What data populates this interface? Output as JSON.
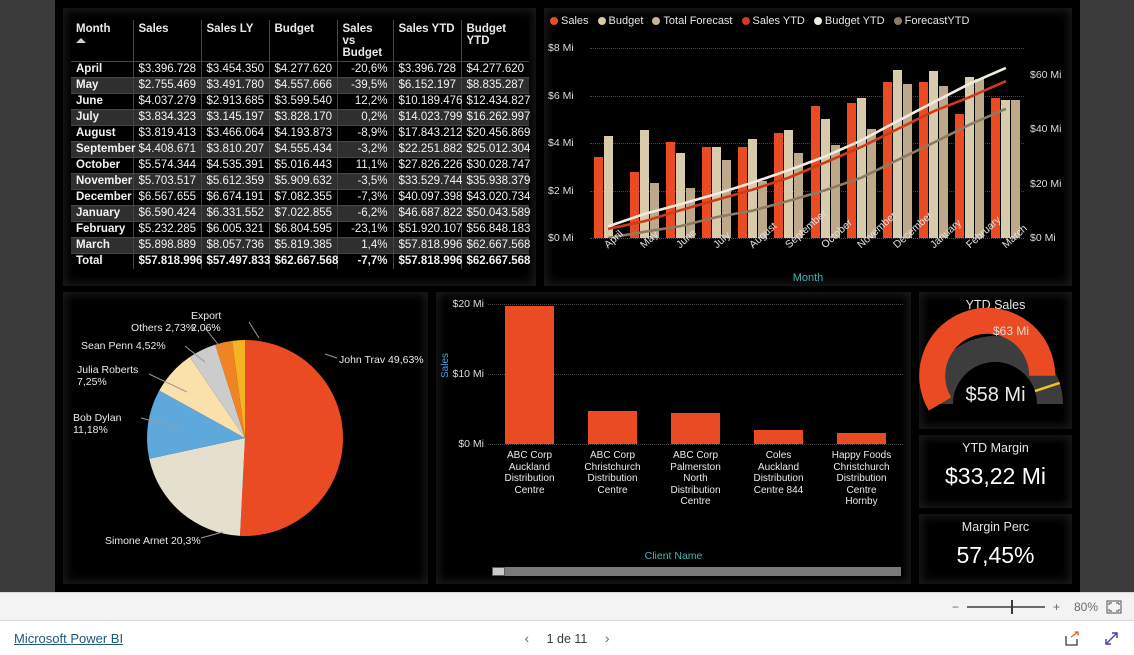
{
  "report": {
    "brand": "Microsoft Power BI",
    "page_indicator": "1 de 11",
    "prev_arrow": "‹",
    "next_arrow": "›",
    "zoom_level": "80%",
    "zoom_minus": "−",
    "zoom_plus": "+",
    "accent_orange": "#eb4b22",
    "accent_tan": "#d8cbab",
    "accent_forecast": "#bda889",
    "canvas_bg": "#000000",
    "axis_title_color": "#3fb8b0"
  },
  "table": {
    "name": "Monthly Sales Table",
    "sort_column": "Month",
    "sort_direction": "ascending",
    "columns": [
      "Month",
      "Sales",
      "Sales LY",
      "Budget",
      "Sales vs Budget",
      "Sales YTD",
      "Budget YTD"
    ],
    "rows": [
      {
        "month": "April",
        "sales": "$3.396.728",
        "sales_ly": "$3.454.350",
        "budget": "$4.277.620",
        "svb": "-20,6%",
        "sales_ytd": "$3.396.728",
        "budget_ytd": "$4.277.620"
      },
      {
        "month": "May",
        "sales": "$2.755.469",
        "sales_ly": "$3.491.780",
        "budget": "$4.557.666",
        "svb": "-39,5%",
        "sales_ytd": "$6.152.197",
        "budget_ytd": "$8.835.287"
      },
      {
        "month": "June",
        "sales": "$4.037.279",
        "sales_ly": "$2.913.685",
        "budget": "$3.599.540",
        "svb": "12,2%",
        "sales_ytd": "$10.189.476",
        "budget_ytd": "$12.434.827"
      },
      {
        "month": "July",
        "sales": "$3.834.323",
        "sales_ly": "$3.145.197",
        "budget": "$3.828.170",
        "svb": "0,2%",
        "sales_ytd": "$14.023.799",
        "budget_ytd": "$16.262.997"
      },
      {
        "month": "August",
        "sales": "$3.819.413",
        "sales_ly": "$3.466.064",
        "budget": "$4.193.873",
        "svb": "-8,9%",
        "sales_ytd": "$17.843.212",
        "budget_ytd": "$20.456.869"
      },
      {
        "month": "September",
        "sales": "$4.408.671",
        "sales_ly": "$3.810.207",
        "budget": "$4.555.434",
        "svb": "-3,2%",
        "sales_ytd": "$22.251.882",
        "budget_ytd": "$25.012.304"
      },
      {
        "month": "October",
        "sales": "$5.574.344",
        "sales_ly": "$4.535.391",
        "budget": "$5.016.443",
        "svb": "11,1%",
        "sales_ytd": "$27.826.226",
        "budget_ytd": "$30.028.747"
      },
      {
        "month": "November",
        "sales": "$5.703.517",
        "sales_ly": "$5.612.359",
        "budget": "$5.909.632",
        "svb": "-3,5%",
        "sales_ytd": "$33.529.744",
        "budget_ytd": "$35.938.379"
      },
      {
        "month": "December",
        "sales": "$6.567.655",
        "sales_ly": "$6.674.191",
        "budget": "$7.082.355",
        "svb": "-7,3%",
        "sales_ytd": "$40.097.398",
        "budget_ytd": "$43.020.734"
      },
      {
        "month": "January",
        "sales": "$6.590.424",
        "sales_ly": "$6.331.552",
        "budget": "$7.022.855",
        "svb": "-6,2%",
        "sales_ytd": "$46.687.822",
        "budget_ytd": "$50.043.589"
      },
      {
        "month": "February",
        "sales": "$5.232.285",
        "sales_ly": "$6.005.321",
        "budget": "$6.804.595",
        "svb": "-23,1%",
        "sales_ytd": "$51.920.107",
        "budget_ytd": "$56.848.183"
      },
      {
        "month": "March",
        "sales": "$5.898.889",
        "sales_ly": "$8.057.736",
        "budget": "$5.819.385",
        "svb": "1,4%",
        "sales_ytd": "$57.818.996",
        "budget_ytd": "$62.667.568"
      },
      {
        "month": "Total",
        "sales": "$57.818.996",
        "sales_ly": "$57.497.833",
        "budget": "$62.667.568",
        "svb": "-7,7%",
        "sales_ytd": "$57.818.996",
        "budget_ytd": "$62.667.568"
      }
    ]
  },
  "chart_data": [
    {
      "id": "combo",
      "type": "bar",
      "title": "",
      "xlabel": "Month",
      "ylabel": "",
      "categories": [
        "April",
        "May",
        "June",
        "July",
        "August",
        "September",
        "October",
        "November",
        "December",
        "January",
        "February",
        "March"
      ],
      "ylim": [
        0,
        8
      ],
      "ytick_labels": [
        "$0 Mi",
        "$2 Mi",
        "$4 Mi",
        "$6 Mi",
        "$8 Mi"
      ],
      "ytick_values": [
        0,
        2,
        4,
        6,
        8
      ],
      "y2lim": [
        0,
        70
      ],
      "y2tick_labels": [
        "$0 Mi",
        "$20 Mi",
        "$40 Mi",
        "$60 Mi"
      ],
      "y2tick_values": [
        0,
        20,
        40,
        60
      ],
      "grid": true,
      "legend": [
        "Sales",
        "Budget",
        "Total Forecast",
        "Sales YTD",
        "Budget YTD",
        "ForecastYTD"
      ],
      "legend_colors": [
        "#eb4b22",
        "#d8cbab",
        "#c8b595",
        "#cf3b18",
        "#f0ece0",
        "#8c7b63"
      ],
      "legend_position": "top",
      "series": [
        {
          "name": "Sales",
          "kind": "bar",
          "color": "#eb4b22",
          "axis": "left",
          "values": [
            3.4,
            2.76,
            4.04,
            3.83,
            3.82,
            4.41,
            5.57,
            5.7,
            6.57,
            6.59,
            5.23,
            5.9
          ]
        },
        {
          "name": "Budget",
          "kind": "bar",
          "color": "#d8cbab",
          "axis": "left",
          "values": [
            4.28,
            4.56,
            3.6,
            3.83,
            4.19,
            4.56,
            5.02,
            5.91,
            7.08,
            7.02,
            6.8,
            5.82
          ]
        },
        {
          "name": "Total Forecast",
          "kind": "bar",
          "color": "#bda889",
          "axis": "left",
          "values": [
            0.0,
            2.3,
            2.1,
            3.3,
            2.4,
            3.6,
            3.9,
            4.6,
            6.5,
            6.4,
            6.7,
            5.8
          ]
        },
        {
          "name": "Sales YTD",
          "kind": "line",
          "color": "#cf3b18",
          "axis": "right",
          "values": [
            3.4,
            6.15,
            10.19,
            14.02,
            17.84,
            22.25,
            27.83,
            33.53,
            40.1,
            46.69,
            51.92,
            57.82
          ]
        },
        {
          "name": "Budget YTD",
          "kind": "line",
          "color": "#f0ece0",
          "axis": "right",
          "values": [
            4.28,
            8.84,
            12.43,
            16.26,
            20.46,
            25.01,
            30.03,
            35.94,
            43.02,
            50.04,
            56.85,
            62.67
          ]
        },
        {
          "name": "ForecastYTD",
          "kind": "line",
          "color": "#8c7b63",
          "axis": "right",
          "values": [
            0.0,
            2.3,
            4.4,
            7.7,
            10.1,
            13.7,
            17.6,
            22.2,
            28.7,
            35.1,
            41.8,
            47.6
          ]
        }
      ]
    },
    {
      "id": "pie",
      "type": "pie",
      "title": "",
      "labels": [
        "John Trav",
        "Simone Arnet",
        "Bob Dylan",
        "Julia Roberts",
        "Sean Penn",
        "Others",
        "Export"
      ],
      "values": [
        49.63,
        20.3,
        11.18,
        7.25,
        4.52,
        2.73,
        2.06
      ],
      "value_labels": [
        "John Trav 49,63%",
        "Simone Arnet 20,3%",
        "Bob Dylan\n11,18%",
        "Julia Roberts\n7,25%",
        "Sean Penn 4,52%",
        "Others 2,73%",
        "Export\n2,06%"
      ],
      "colors": [
        "#eb4b22",
        "#e5dfcd",
        "#5fa8dc",
        "#fae0aa",
        "#cccccc",
        "#f08322",
        "#f5b323"
      ],
      "legend_position": "labels"
    },
    {
      "id": "client-sales",
      "type": "bar",
      "title": "",
      "xlabel": "Client Name",
      "ylabel": "Sales",
      "categories": [
        "ABC Corp Auckland Distribution Centre",
        "ABC Corp Christchurch Distribution Centre",
        "ABC Corp Palmerston North Distribution Centre",
        "Coles Auckland Distribution Centre 844",
        "Happy Foods Christchurch Distribution Centre Hornby"
      ],
      "values": [
        19.7,
        4.7,
        4.4,
        2.0,
        1.6
      ],
      "ylim": [
        0,
        20
      ],
      "ytick_labels": [
        "$0 Mi",
        "$10 Mi",
        "$20 Mi"
      ],
      "ytick_values": [
        0,
        10,
        20
      ],
      "grid": true,
      "color": "#eb4b22"
    }
  ],
  "kpis": {
    "gauge": {
      "title": "YTD Sales",
      "value": "$58 Mi",
      "target": "$63 Mi",
      "value_number": 58,
      "target_number": 63,
      "max_number": 70,
      "fill_color": "#eb4b22",
      "track_color": "#3d3d3d",
      "target_color": "#f5c518"
    },
    "margin": {
      "title": "YTD Margin",
      "value": "$33,22 Mi"
    },
    "margin_perc": {
      "title": "Margin Perc",
      "value": "57,45%"
    }
  },
  "icons": {
    "fit_page": "fit-page-icon",
    "share": "share-icon",
    "fullscreen": "fullscreen-icon"
  }
}
